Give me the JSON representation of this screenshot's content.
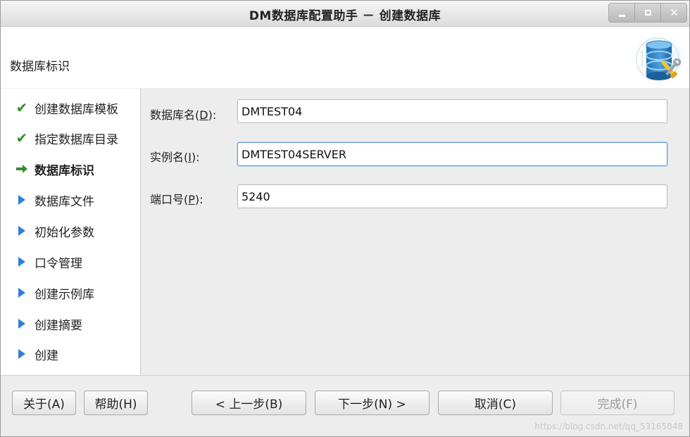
{
  "window": {
    "title": "DM数据库配置助手 － 创建数据库",
    "controls": {
      "minimize": "minimize-icon",
      "maximize": "maximize-icon",
      "close": "close-icon"
    }
  },
  "header": {
    "title": "数据库标识",
    "icon": "database-icon"
  },
  "sidebar": {
    "steps": [
      {
        "label": "创建数据库模板",
        "status": "done",
        "icon": "check-icon"
      },
      {
        "label": "指定数据库目录",
        "status": "done",
        "icon": "check-icon"
      },
      {
        "label": "数据库标识",
        "status": "current",
        "icon": "arrow-right-icon"
      },
      {
        "label": "数据库文件",
        "status": "pending",
        "icon": "triangle-right-icon"
      },
      {
        "label": "初始化参数",
        "status": "pending",
        "icon": "triangle-right-icon"
      },
      {
        "label": "口令管理",
        "status": "pending",
        "icon": "triangle-right-icon"
      },
      {
        "label": "创建示例库",
        "status": "pending",
        "icon": "triangle-right-icon"
      },
      {
        "label": "创建摘要",
        "status": "pending",
        "icon": "triangle-right-icon"
      },
      {
        "label": "创建",
        "status": "pending",
        "icon": "triangle-right-icon"
      }
    ]
  },
  "form": {
    "db_name": {
      "label_pre": "数据库名(",
      "mnemonic": "D",
      "label_post": "):",
      "value": "DMTEST04"
    },
    "instance_name": {
      "label_pre": "实例名(",
      "mnemonic": "I",
      "label_post": "):",
      "value": "DMTEST04SERVER"
    },
    "port": {
      "label_pre": "端口号(",
      "mnemonic": "P",
      "label_post": "):",
      "value": "5240"
    }
  },
  "buttons": {
    "about": "关于(A)",
    "help": "帮助(H)",
    "prev": "< 上一步(B)",
    "next": "下一步(N) >",
    "cancel": "取消(C)",
    "finish": "完成(F)"
  },
  "watermark": "https://blog.csdn.net/qq_53165848",
  "colors": {
    "check": "#2f8f2f",
    "arrow": "#2e7fd6",
    "focus_border": "#5a9bdc"
  }
}
